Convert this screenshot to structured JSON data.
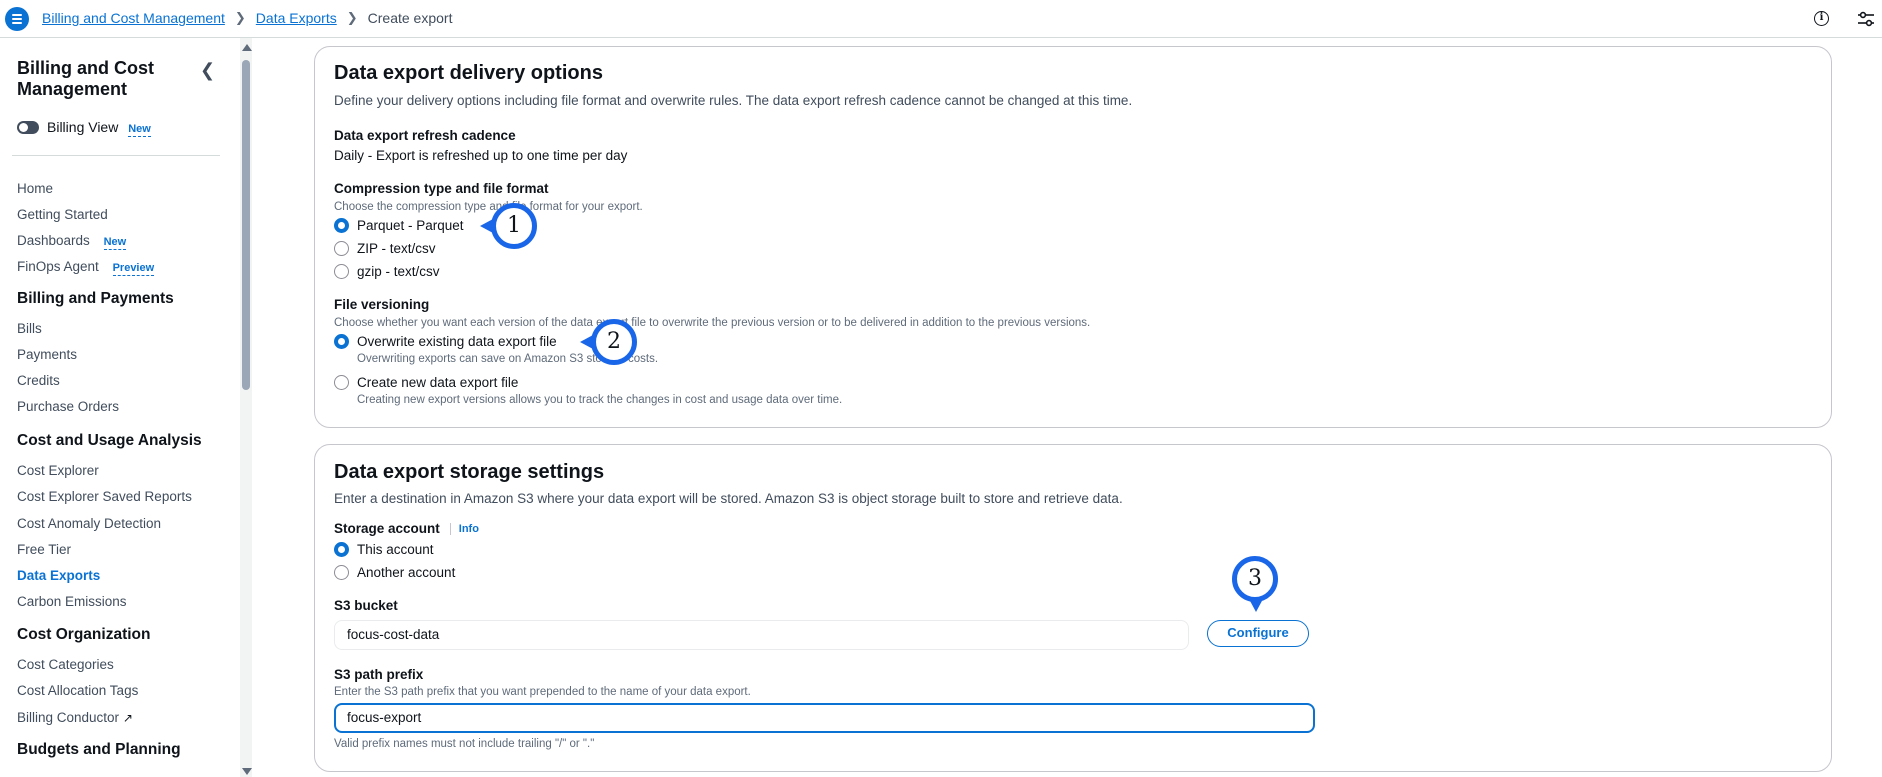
{
  "breadcrumb": {
    "items": [
      "Billing and Cost Management",
      "Data Exports"
    ],
    "current": "Create export"
  },
  "sidebar": {
    "title": "Billing and Cost Management",
    "billing_view": {
      "label": "Billing View",
      "badge": "New"
    },
    "items_top": [
      {
        "label": "Home"
      },
      {
        "label": "Getting Started"
      },
      {
        "label": "Dashboards",
        "badge": "New"
      },
      {
        "label": "FinOps Agent",
        "badge": "Preview"
      }
    ],
    "sections": [
      {
        "title": "Billing and Payments",
        "items": [
          "Bills",
          "Payments",
          "Credits",
          "Purchase Orders"
        ]
      },
      {
        "title": "Cost and Usage Analysis",
        "items": [
          "Cost Explorer",
          "Cost Explorer Saved Reports",
          "Cost Anomaly Detection",
          "Free Tier",
          "Data Exports",
          "Carbon Emissions"
        ]
      },
      {
        "title": "Cost Organization",
        "items": [
          "Cost Categories",
          "Cost Allocation Tags",
          "Billing Conductor"
        ]
      },
      {
        "title": "Budgets and Planning",
        "items": []
      }
    ],
    "active_item": "Data Exports"
  },
  "delivery": {
    "title": "Data export delivery options",
    "description": "Define your delivery options including file format and overwrite rules. The data export refresh cadence cannot be changed at this time.",
    "cadence_label": "Data export refresh cadence",
    "cadence_value": "Daily - Export is refreshed up to one time per day",
    "compression_label": "Compression type and file format",
    "compression_help": "Choose the compression type and file format for your export.",
    "compression_options": [
      "Parquet - Parquet",
      "ZIP - text/csv",
      "gzip - text/csv"
    ],
    "compression_selected": "Parquet - Parquet",
    "versioning_label": "File versioning",
    "versioning_help": "Choose whether you want each version of the data export file to overwrite the previous version or to be delivered in addition to the previous versions.",
    "versioning_options": [
      {
        "label": "Overwrite existing data export file",
        "desc": "Overwriting exports can save on Amazon S3 storage costs."
      },
      {
        "label": "Create new data export file",
        "desc": "Creating new export versions allows you to track the changes in cost and usage data over time."
      }
    ],
    "versioning_selected": "Overwrite existing data export file"
  },
  "storage": {
    "title": "Data export storage settings",
    "description": "Enter a destination in Amazon S3 where your data export will be stored. Amazon S3 is object storage built to store and retrieve data.",
    "account_label": "Storage account",
    "info_link": "Info",
    "account_options": [
      "This account",
      "Another account"
    ],
    "account_selected": "This account",
    "bucket_label": "S3 bucket",
    "bucket_value": "focus-cost-data",
    "configure_label": "Configure",
    "prefix_label": "S3 path prefix",
    "prefix_help": "Enter the S3 path prefix that you want prepended to the name of your data export.",
    "prefix_value": "focus-export",
    "prefix_note": "Valid prefix names must not include trailing \"/\" or \".\""
  },
  "markers": [
    "1",
    "2",
    "3"
  ],
  "colors": {
    "accent": "#0972d3",
    "marker": "#1a66e8"
  }
}
